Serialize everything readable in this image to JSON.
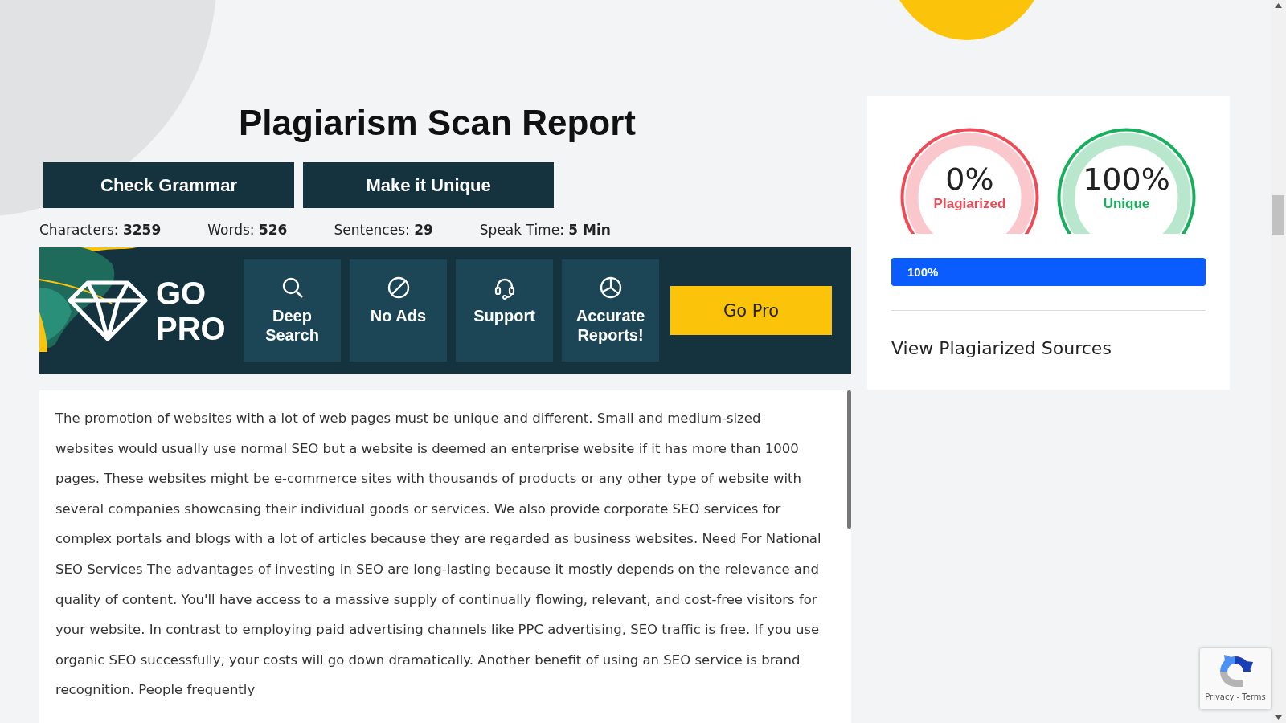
{
  "title": "Plagiarism Scan Report",
  "actions": [
    "Check Grammar",
    "Make it Unique"
  ],
  "stats": [
    "Characters: **3259**",
    "Words: **526**",
    "Sentences: **29**",
    "Speak Time: **5 Min**"
  ],
  "go_pro_banner": {
    "heading": [
      "GO",
      "PRO"
    ],
    "features": [
      {
        "kind": "search",
        "label": "Deep Search"
      },
      {
        "kind": "noads",
        "label": "No Ads"
      },
      {
        "kind": "support",
        "label": "Support"
      },
      {
        "kind": "reports",
        "label": "Accurate Reports!"
      }
    ],
    "button": "Go Pro"
  },
  "content": "The promotion of websites with a lot of web pages must be unique and different. Small and medium-sized websites would usually use normal SEO but a website is deemed an enterprise website if it has more than 1000 pages. These websites might be e-commerce sites with thousands of products or any other type of website with several companies showcasing their individual goods or services. We also provide corporate SEO services for complex portals and blogs with a lot of articles because they are regarded as business websites. Need For National SEO Services The advantages of investing in SEO are long-lasting because it mostly depends on the relevance and quality of content. You'll have access to a massive supply of continually flowing, relevant, and cost-free visitors for your website. In contrast to employing paid advertising channels like PPC advertising, SEO traffic is free. If you use organic SEO successfully, your costs will go down dramatically. Another benefit of using an SEO service is brand recognition. People frequently",
  "result": {
    "gauges": [
      {
        "value": "0%",
        "label": "Plagiarized",
        "color": "#ef4a55"
      },
      {
        "value": "100%",
        "label": "Unique",
        "color": "#16b05c"
      }
    ],
    "progress": {
      "level": 1,
      "reading": "100%"
    },
    "sources_link": "View Plagiarized Sources"
  },
  "recaptcha": {
    "links": "Privacy - Terms"
  }
}
